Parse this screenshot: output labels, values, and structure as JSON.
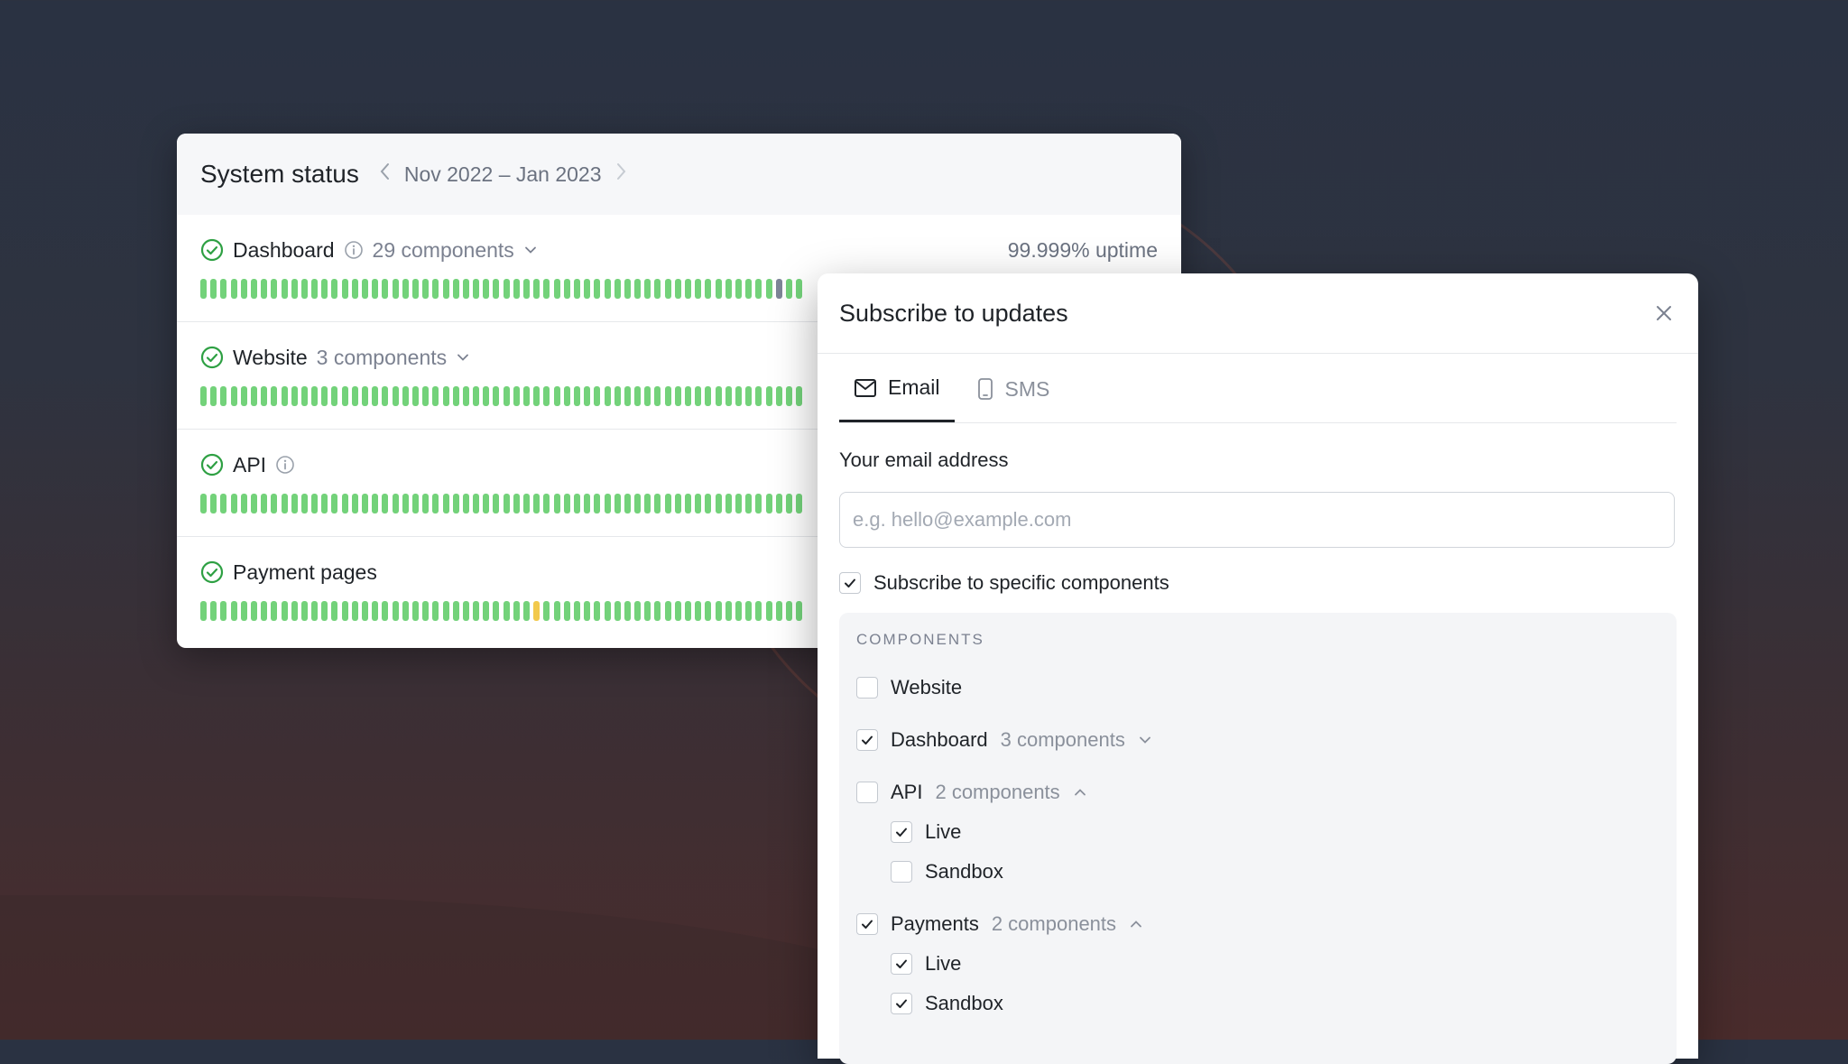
{
  "colors": {
    "bar_ok": "#73d27a",
    "bar_warn": "#f2c94c",
    "bar_degraded": "#7d8597",
    "ok_icon": "#2ea043",
    "text_primary": "#1f2328",
    "text_muted": "#7b8190"
  },
  "status": {
    "title": "System status",
    "range": "Nov 2022 – Jan 2023",
    "rows": [
      {
        "name": "Dashboard",
        "count": "29 components",
        "uptime": "99.999% uptime",
        "icon": "check-circle-icon"
      },
      {
        "name": "Website",
        "count": "3 components",
        "icon": "check-circle-icon"
      },
      {
        "name": "API",
        "icon": "check-circle-icon"
      },
      {
        "name": "Payment pages",
        "icon": "check-circle-icon"
      }
    ]
  },
  "modal": {
    "title": "Subscribe to updates",
    "tabs": [
      {
        "label": "Email",
        "icon": "mail-icon",
        "active": true
      },
      {
        "label": "SMS",
        "icon": "phone-icon",
        "active": false
      }
    ],
    "email_label": "Your email address",
    "email_placeholder": "e.g. hello@example.com",
    "email_value": "",
    "specific_label": "Subscribe to specific components",
    "specific_checked": true,
    "components_heading": "COMPONENTS",
    "components": [
      {
        "label": "Website",
        "checked": false
      },
      {
        "label": "Dashboard",
        "count": "3 components",
        "checked": true,
        "expanded": false
      },
      {
        "label": "API",
        "count": "2 components",
        "checked": false,
        "expanded": true,
        "children": [
          {
            "label": "Live",
            "checked": true
          },
          {
            "label": "Sandbox",
            "checked": false
          }
        ]
      },
      {
        "label": "Payments",
        "count": "2 components",
        "checked": true,
        "expanded": true,
        "children": [
          {
            "label": "Live",
            "checked": true
          },
          {
            "label": "Sandbox",
            "checked": true
          }
        ]
      }
    ]
  }
}
